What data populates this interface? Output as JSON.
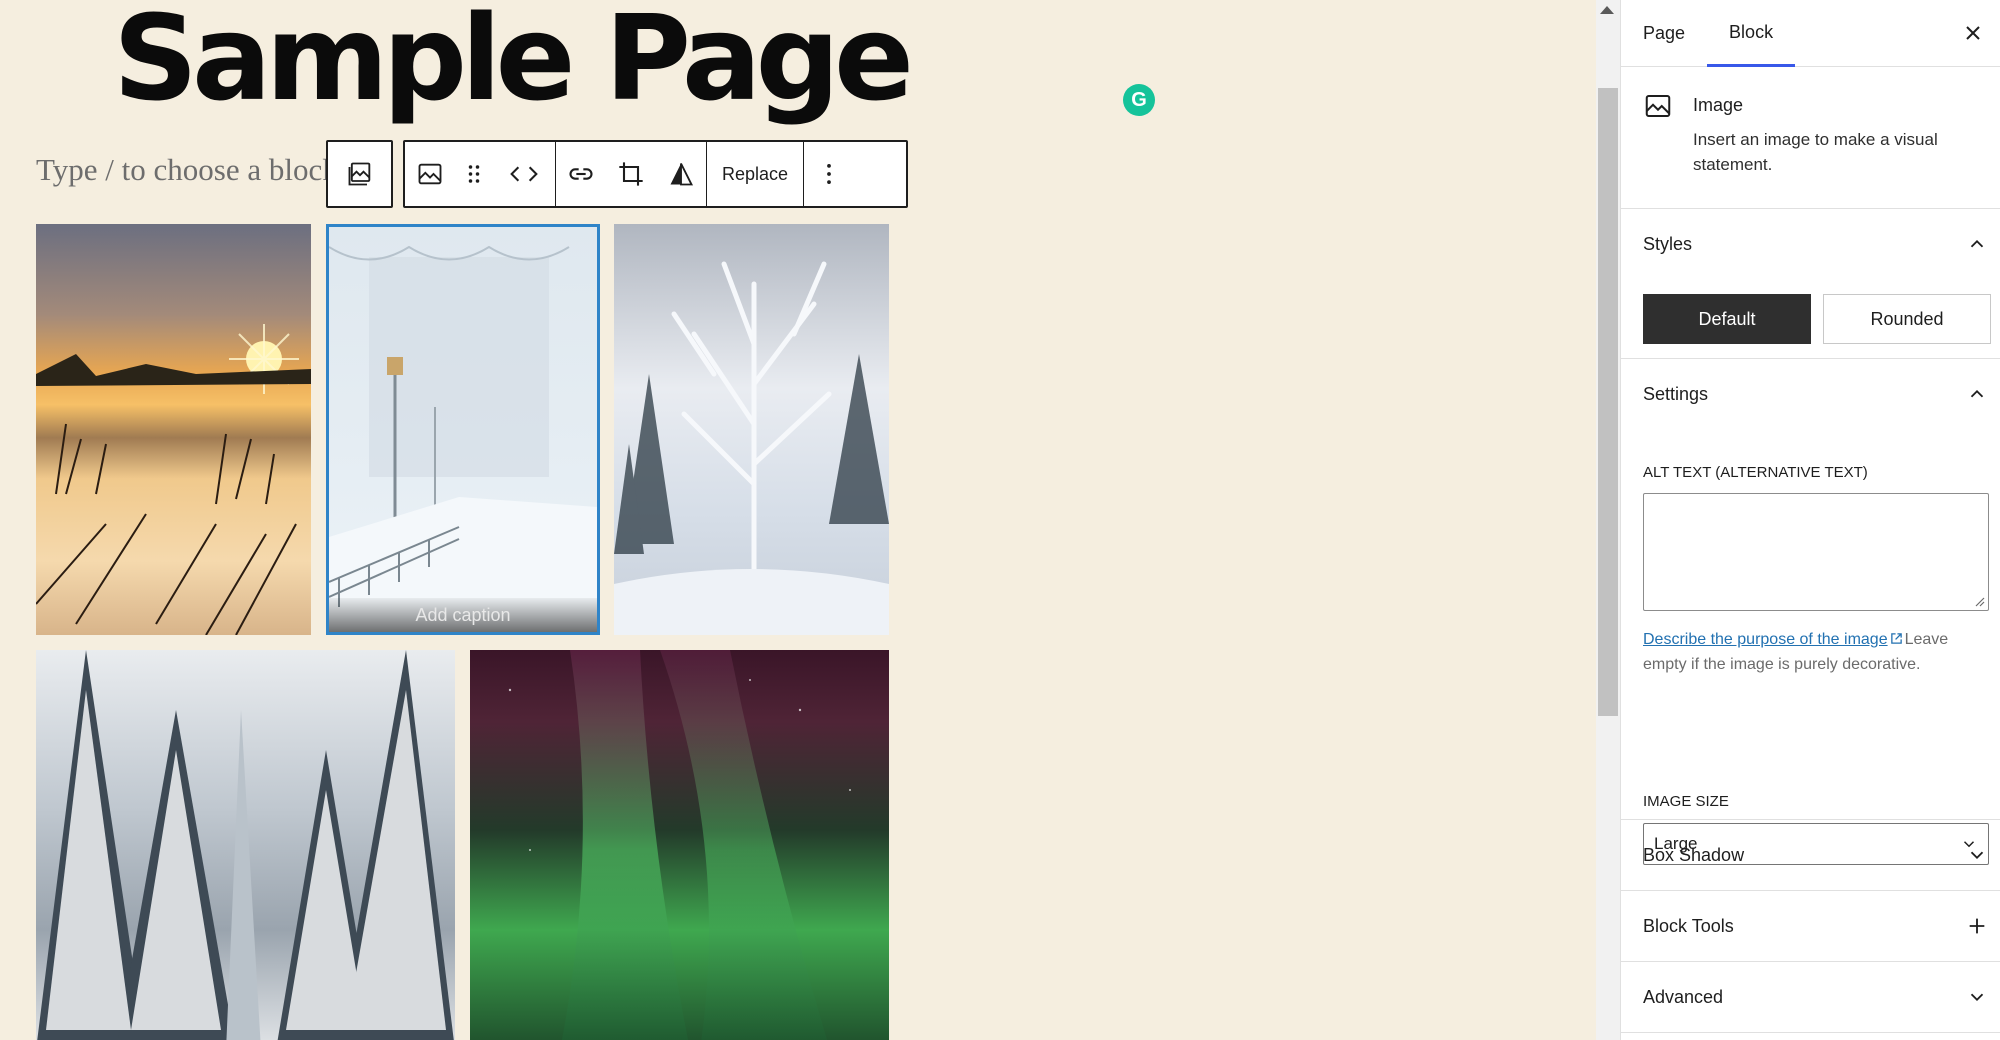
{
  "page": {
    "title": "Sample Page",
    "block_placeholder": "Type / to choose a block"
  },
  "toolbar": {
    "parent_icon": "gallery-icon",
    "replace_label": "Replace"
  },
  "gallery": {
    "caption_placeholder": "Add caption"
  },
  "sidebar": {
    "tabs": [
      {
        "label": "Page"
      },
      {
        "label": "Block"
      }
    ],
    "active_tab": "Block",
    "block_card": {
      "title": "Image",
      "description": "Insert an image to make a visual statement."
    },
    "styles": {
      "title": "Styles",
      "options": [
        {
          "label": "Default"
        },
        {
          "label": "Rounded"
        }
      ],
      "selected": "Default"
    },
    "settings": {
      "title": "Settings",
      "alt_label": "ALT TEXT (ALTERNATIVE TEXT)",
      "alt_value": "",
      "alt_help_link": "Describe the purpose of the image",
      "alt_help_text": "Leave empty if the image is purely decorative.",
      "image_size_label": "IMAGE SIZE",
      "image_size_value": "Large"
    },
    "panels": [
      {
        "title": "Box Shadow",
        "icon": "chevron-down-icon"
      },
      {
        "title": "Block Tools",
        "icon": "plus-icon"
      },
      {
        "title": "Advanced",
        "icon": "chevron-down-icon"
      }
    ]
  },
  "colors": {
    "canvas_bg": "#f5eedf",
    "accent": "#3858e9",
    "selection": "#2f84c8",
    "link": "#2271b1",
    "grammarly": "#15c39a"
  }
}
